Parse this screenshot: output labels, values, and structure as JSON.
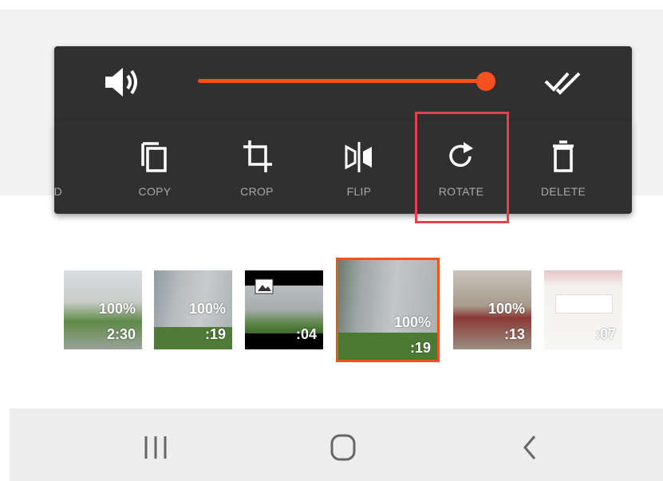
{
  "volume": {
    "icon": "volume-icon",
    "level": 1.0,
    "accent_color": "#f5511e",
    "apply_all_icon": "double-check-icon"
  },
  "toolbar": {
    "items": [
      {
        "label": "ED",
        "icon": "speed-icon"
      },
      {
        "label": "COPY",
        "icon": "copy-icon"
      },
      {
        "label": "CROP",
        "icon": "crop-icon"
      },
      {
        "label": "FLIP",
        "icon": "flip-icon"
      },
      {
        "label": "ROTATE",
        "icon": "rotate-icon"
      },
      {
        "label": "DELETE",
        "icon": "delete-icon"
      }
    ],
    "highlighted": "ROTATE",
    "highlight_color": "#e14150"
  },
  "timeline": {
    "clips": [
      {
        "percent": "100%",
        "duration": "2:30"
      },
      {
        "percent": "100%",
        "duration": ":19"
      },
      {
        "percent": "",
        "duration": ":04",
        "badge": "image-icon"
      },
      {
        "percent": "100%",
        "duration": ":19",
        "selected": true
      },
      {
        "percent": "100%",
        "duration": ":13"
      },
      {
        "percent": "",
        "duration": ":07"
      }
    ]
  },
  "navbar": {
    "recent_icon": "recent-apps-icon",
    "home_icon": "home-icon",
    "back_icon": "back-icon"
  }
}
